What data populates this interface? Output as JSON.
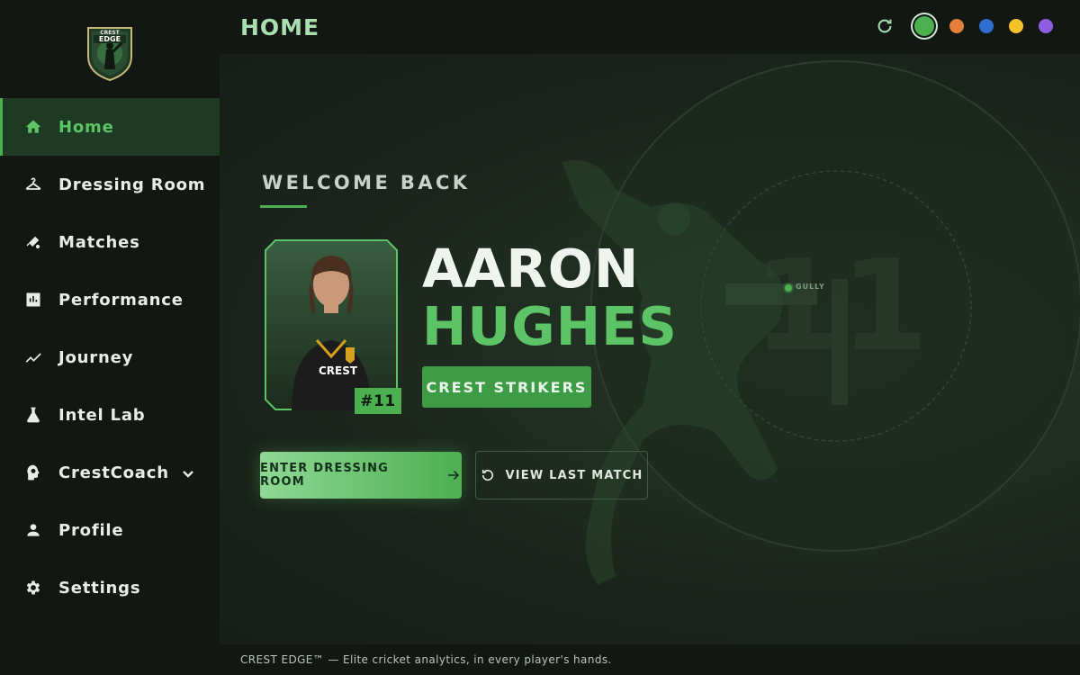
{
  "app": {
    "logo_text_top": "CREST",
    "logo_text_bottom": "EDGE"
  },
  "header": {
    "title": "HOME",
    "theme_colors": [
      "#4caf50",
      "#e67e3c",
      "#2f6fd1",
      "#f4c22b",
      "#8d5fe0"
    ],
    "selected_theme": 0
  },
  "sidebar": {
    "items": [
      {
        "label": "Home",
        "icon": "home-icon",
        "active": true
      },
      {
        "label": "Dressing Room",
        "icon": "hanger-icon"
      },
      {
        "label": "Matches",
        "icon": "cricket-bat-icon"
      },
      {
        "label": "Performance",
        "icon": "bar-chart-icon"
      },
      {
        "label": "Journey",
        "icon": "trend-line-icon"
      },
      {
        "label": "Intel Lab",
        "icon": "flask-icon"
      },
      {
        "label": "CrestCoach",
        "icon": "coach-head-icon",
        "expandable": true
      },
      {
        "label": "Profile",
        "icon": "person-icon"
      },
      {
        "label": "Settings",
        "icon": "gear-icon"
      }
    ]
  },
  "main": {
    "welcome": "WELCOME BACK",
    "first_name": "AARON",
    "last_name": "HUGHES",
    "jersey_number": "#11",
    "team": "CREST STRIKERS",
    "primary_button": "ENTER DRESSING ROOM",
    "secondary_button": "VIEW LAST MATCH",
    "field_label": "GULLY",
    "bg_number": "11",
    "accent": "#4caf50"
  },
  "footer": {
    "text": "CREST EDGE™ — Elite cricket analytics, in every player's hands."
  }
}
